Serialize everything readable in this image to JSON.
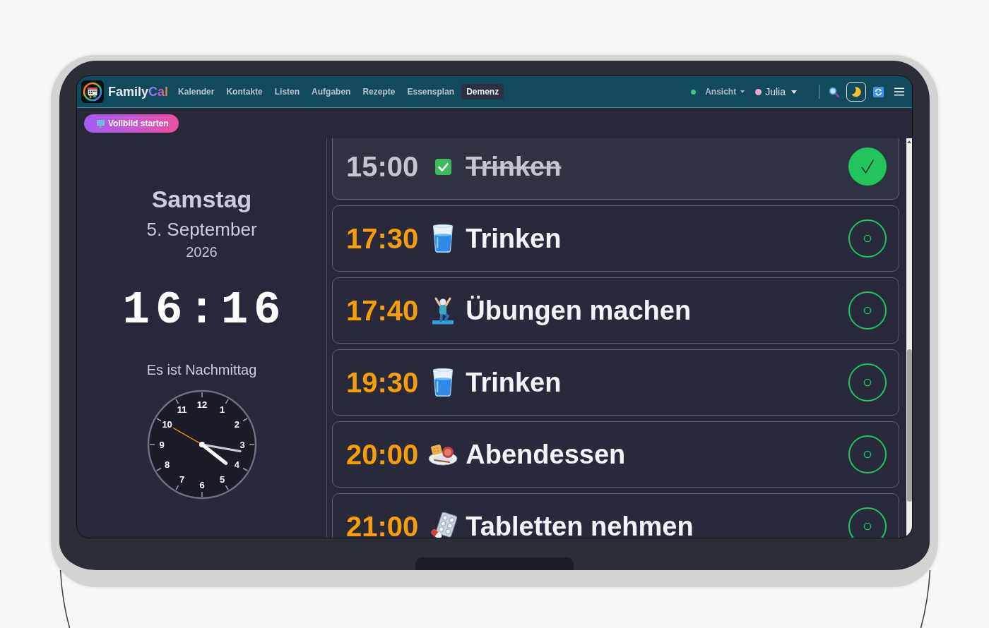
{
  "nav": {
    "brand": {
      "name": "Family",
      "accent": "Cal"
    },
    "links": [
      {
        "label": "Kalender",
        "selected": false
      },
      {
        "label": "Kontakte",
        "selected": false
      },
      {
        "label": "Listen",
        "selected": false
      },
      {
        "label": "Aufgaben",
        "selected": false
      },
      {
        "label": "Rezepte",
        "selected": false
      },
      {
        "label": "Essensplan",
        "selected": false
      },
      {
        "label": "Demenz",
        "selected": true
      }
    ],
    "connection": {
      "online": true
    },
    "view_menu": {
      "label": "Ansicht"
    },
    "user_menu": {
      "label": "Julia"
    },
    "theme_toggle": {
      "dark": true
    }
  },
  "fullscreen_button": {
    "label": "Vollbild starten"
  },
  "today": {
    "weekday": "Samstag",
    "date": "5. September",
    "year": "2026",
    "time": "16:16",
    "period": "Es ist Nachmittag"
  },
  "analog_clock": {
    "numerals": [
      "12",
      "1",
      "2",
      "3",
      "4",
      "5",
      "6",
      "7",
      "8",
      "9",
      "10",
      "11"
    ],
    "second_hand": true
  },
  "tasks": [
    {
      "time": "15:00",
      "title": "Trinken",
      "done": true
    },
    {
      "time": "17:30",
      "title": "Trinken",
      "kind": "drink",
      "done": false
    },
    {
      "time": "17:40",
      "title": "Übungen machen",
      "kind": "exercise",
      "done": false
    },
    {
      "time": "19:30",
      "title": "Trinken",
      "kind": "drink",
      "done": false
    },
    {
      "time": "20:00",
      "title": "Abendessen",
      "kind": "meal",
      "done": false
    },
    {
      "time": "21:00",
      "title": "Tabletten nehmen",
      "kind": "medication",
      "done": false
    }
  ]
}
